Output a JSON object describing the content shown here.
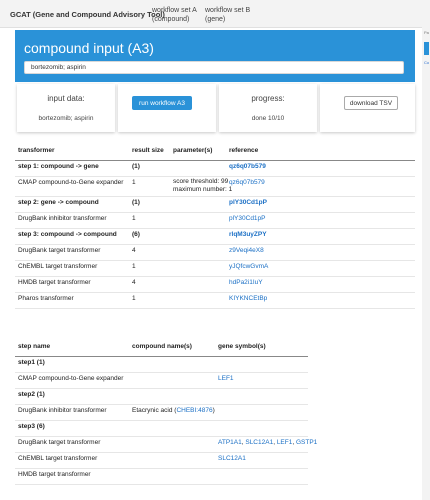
{
  "app": {
    "brand": "GCAT (Gene and Compound Advisory Tool)",
    "nav_a": [
      "workflow set A",
      "(compound)"
    ],
    "nav_b": [
      "workflow set B",
      "(gene)"
    ]
  },
  "hero": {
    "title": "compound input (A3)",
    "input_value": "bortezomib; aspirin"
  },
  "side": {
    "label": "Pa",
    "link": "Co"
  },
  "cards": {
    "input_title": "input data:",
    "input_value": "bortezomib; aspirin",
    "run_label": "run workflow A3",
    "progress_title": "progress:",
    "progress_value": "done 10/10",
    "download_label": "download TSV"
  },
  "table1": {
    "headers": [
      "transformer",
      "result size",
      "parameter(s)",
      "reference"
    ],
    "rows": [
      {
        "transformer": "step 1: compound -> gene",
        "size": "(1)",
        "params": "",
        "params2": "",
        "ref": "qz6q07b579",
        "kind": "step"
      },
      {
        "transformer": "CMAP compound-to-Gene expander",
        "size": "1",
        "params": "score threshold: 99",
        "params2": "maximum number: 1",
        "ref": "qz6q07b579",
        "kind": "row"
      },
      {
        "transformer": "step 2: gene -> compound",
        "size": "(1)",
        "params": "",
        "params2": "",
        "ref": "plY30Cd1pP",
        "kind": "step"
      },
      {
        "transformer": "DrugBank inhibitor transformer",
        "size": "1",
        "params": "",
        "params2": "",
        "ref": "plY30Cd1pP",
        "kind": "row"
      },
      {
        "transformer": "step 3: compound -> compound",
        "size": "(6)",
        "params": "",
        "params2": "",
        "ref": "rlqM3uyZPY",
        "kind": "step"
      },
      {
        "transformer": "DrugBank target transformer",
        "size": "4",
        "params": "",
        "params2": "",
        "ref": "z9Veqi4eX8",
        "kind": "row"
      },
      {
        "transformer": "ChEMBL target transformer",
        "size": "1",
        "params": "",
        "params2": "",
        "ref": "yJQfcwGvmA",
        "kind": "row"
      },
      {
        "transformer": "HMDB target transformer",
        "size": "4",
        "params": "",
        "params2": "",
        "ref": "hdPa2i1IuY",
        "kind": "row"
      },
      {
        "transformer": "Pharos transformer",
        "size": "1",
        "params": "",
        "params2": "",
        "ref": "KIYKNCEtBp",
        "kind": "row"
      }
    ]
  },
  "table2": {
    "headers": [
      "step name",
      "compound name(s)",
      "gene symbol(s)"
    ],
    "rows": [
      {
        "step": "step1 (1)",
        "compound": "",
        "compound_link": "",
        "compound_tail": "",
        "genes": [],
        "kind": "step"
      },
      {
        "step": "CMAP compound-to-Gene expander",
        "compound": "",
        "compound_link": "",
        "compound_tail": "",
        "genes": [
          "LEF1"
        ],
        "kind": "row"
      },
      {
        "step": "step2 (1)",
        "compound": "",
        "compound_link": "",
        "compound_tail": "",
        "genes": [],
        "kind": "step"
      },
      {
        "step": "DrugBank inhibitor transformer",
        "compound": "Etacrynic acid (",
        "compound_link": "CHEBI:4876",
        "compound_tail": ")",
        "genes": [],
        "kind": "row"
      },
      {
        "step": "step3 (6)",
        "compound": "",
        "compound_link": "",
        "compound_tail": "",
        "genes": [],
        "kind": "step"
      },
      {
        "step": "DrugBank target transformer",
        "compound": "",
        "compound_link": "",
        "compound_tail": "",
        "genes": [
          "ATP1A1",
          "SLC12A1",
          "LEF1",
          "GSTP1"
        ],
        "kind": "row"
      },
      {
        "step": "ChEMBL target transformer",
        "compound": "",
        "compound_link": "",
        "compound_tail": "",
        "genes": [
          "SLC12A1"
        ],
        "kind": "row"
      },
      {
        "step": "HMDB target transformer",
        "compound": "",
        "compound_link": "",
        "compound_tail": "",
        "genes": [],
        "kind": "row"
      }
    ]
  }
}
